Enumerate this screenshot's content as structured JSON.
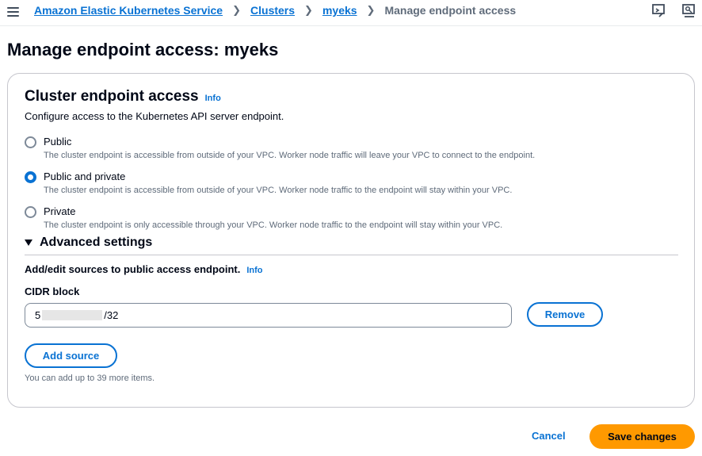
{
  "breadcrumb": {
    "items": [
      "Amazon Elastic Kubernetes Service",
      "Clusters",
      "myeks"
    ],
    "current": "Manage endpoint access"
  },
  "page": {
    "title": "Manage endpoint access: myeks"
  },
  "section": {
    "title": "Cluster endpoint access",
    "info": "Info",
    "description": "Configure access to the Kubernetes API server endpoint."
  },
  "options": [
    {
      "label": "Public",
      "description": "The cluster endpoint is accessible from outside of your VPC. Worker node traffic will leave your VPC to connect to the endpoint.",
      "selected": false
    },
    {
      "label": "Public and private",
      "description": "The cluster endpoint is accessible from outside of your VPC. Worker node traffic to the endpoint will stay within your VPC.",
      "selected": true
    },
    {
      "label": "Private",
      "description": "The cluster endpoint is only accessible through your VPC. Worker node traffic to the endpoint will stay within your VPC.",
      "selected": false
    }
  ],
  "advanced": {
    "title": "Advanced settings",
    "sources_heading": "Add/edit sources to public access endpoint.",
    "info": "Info",
    "cidr_label": "CIDR block",
    "cidr_prefix": "5",
    "cidr_suffix": "/32",
    "remove_label": "Remove",
    "add_source_label": "Add source",
    "hint": "You can add up to 39 more items."
  },
  "footer": {
    "cancel_label": "Cancel",
    "save_label": "Save changes"
  },
  "colors": {
    "link": "#0972d3",
    "primary": "#ff9900",
    "text": "#000716",
    "muted": "#5f6b7a"
  }
}
